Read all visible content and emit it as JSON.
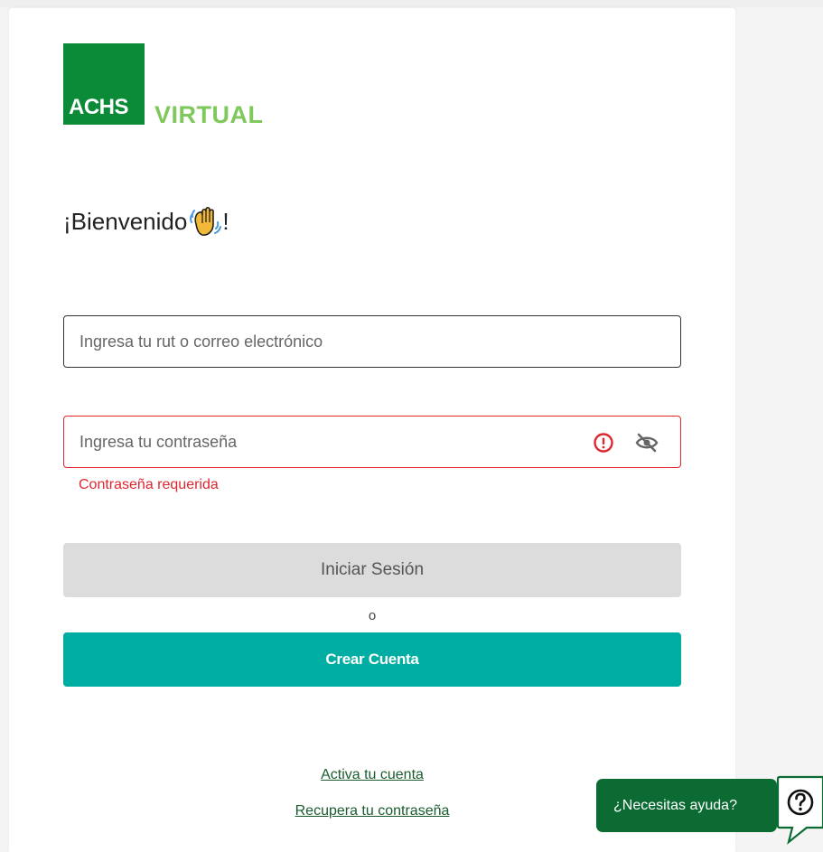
{
  "logo": {
    "brand": "ACHS",
    "product": "VIRTUAL",
    "colors": {
      "box": "#0b8a37",
      "product": "#7ec85c"
    }
  },
  "welcome": {
    "text_before": "¡Bienvenido",
    "icon": "waving-hand-icon",
    "text_after": "!"
  },
  "form": {
    "username": {
      "placeholder": "Ingresa tu rut o correo electrónico",
      "value": ""
    },
    "password": {
      "placeholder": "Ingresa tu contraseña",
      "value": "",
      "error": "Contraseña requerida",
      "icons": [
        "alert-circle-icon",
        "eye-off-icon"
      ]
    },
    "login_button": "Iniciar Sesión",
    "or_text": "o",
    "create_button": "Crear Cuenta"
  },
  "links": {
    "activate": "Activa tu cuenta",
    "recover": "Recupera tu contraseña"
  },
  "help": {
    "label": "¿Necesitas ayuda?",
    "icon": "help-question-icon",
    "colors": {
      "pill": "#0b6b32"
    }
  },
  "colors": {
    "error": "#e0262f",
    "accent": "#00ada3",
    "link": "#1a5c2e"
  }
}
